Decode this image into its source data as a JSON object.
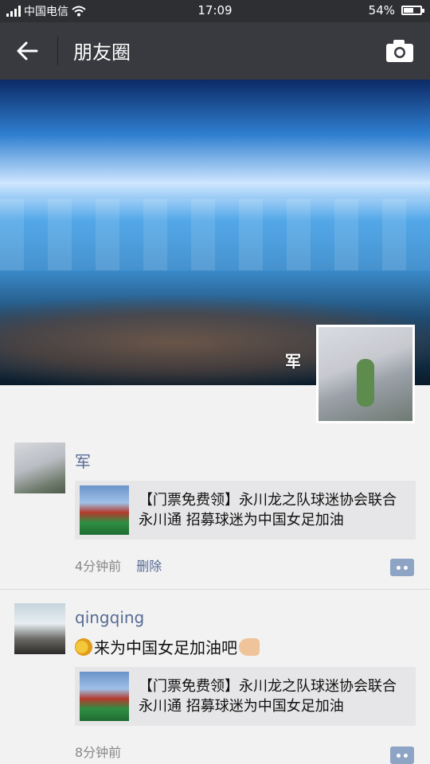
{
  "status_bar": {
    "carrier": "中国电信",
    "time": "17:09",
    "battery": "54%",
    "battery_level": 0.54
  },
  "header": {
    "title": "朋友圈",
    "back_icon": "arrow-left-icon",
    "camera_icon": "camera-icon"
  },
  "cover": {
    "user_name": "军"
  },
  "posts": [
    {
      "author": "军",
      "link_text": "【门票免费领】永川龙之队球迷协会联合永川通 招募球迷为中国女足加油",
      "time": "4分钟前",
      "delete_label": "删除"
    },
    {
      "author": "qingqing",
      "text": "来为中国女足加油吧",
      "link_text": "【门票免费领】永川龙之队球迷协会联合永川通 招募球迷为中国女足加油",
      "time": "8分钟前"
    }
  ],
  "colors": {
    "name_blue": "#576b95",
    "title_bar": "#393a3f"
  }
}
